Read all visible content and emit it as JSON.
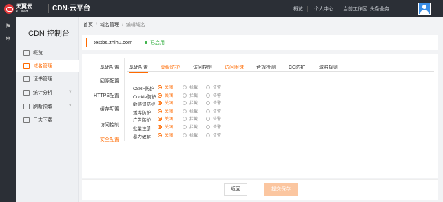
{
  "header": {
    "logo_cn": "天翼云",
    "logo_en": "e Cloud",
    "product_title": "CDN·云平台",
    "links": [
      "概览",
      "个人中心",
      "当前工作区: 头条业务..."
    ]
  },
  "sidebar": {
    "title": "CDN 控制台",
    "items": [
      {
        "label": "概览",
        "active": false
      },
      {
        "label": "域名管理",
        "active": true
      },
      {
        "label": "证书管理",
        "active": false
      },
      {
        "label": "统计分析",
        "active": false,
        "has_caret": true
      },
      {
        "label": "刷新预取",
        "active": false,
        "has_caret": true
      },
      {
        "label": "日志下载",
        "active": false
      }
    ]
  },
  "breadcrumb": {
    "home": "首页",
    "section": "域名管理",
    "current": "编辑域名"
  },
  "domain": {
    "name": "testbs.zhihu.com",
    "status": "已启用",
    "status_color": "#3db34a"
  },
  "config_nav": [
    {
      "label": "基础配置",
      "active": false
    },
    {
      "label": "回源配置",
      "active": false
    },
    {
      "label": "HTTPS配置",
      "active": false
    },
    {
      "label": "缓存配置",
      "active": false
    },
    {
      "label": "访问控制",
      "active": false
    },
    {
      "label": "安全配置",
      "active": true
    }
  ],
  "tabs": [
    {
      "label": "基础配置",
      "state": "active"
    },
    {
      "label": "高级防护",
      "state": "orange"
    },
    {
      "label": "访问控制",
      "state": "normal"
    },
    {
      "label": "访问限速",
      "state": "orange"
    },
    {
      "label": "合规检测",
      "state": "normal"
    },
    {
      "label": "CC防护",
      "state": "normal"
    },
    {
      "label": "域名规则",
      "state": "normal"
    }
  ],
  "rules": {
    "options": [
      "关闭",
      "拦截",
      "告警"
    ],
    "items": [
      {
        "label": "CSRF防护",
        "selected": 0
      },
      {
        "label": "Cookie防护",
        "selected": 0
      },
      {
        "label": "敏感词防护",
        "selected": 0
      },
      {
        "label": "播库防护",
        "selected": 0
      },
      {
        "label": "广告防护",
        "selected": 0
      },
      {
        "label": "批量注册",
        "selected": 0
      },
      {
        "label": "暴力破解",
        "selected": 0
      }
    ]
  },
  "footer": {
    "back_label": "返回",
    "submit_label": "提交保存"
  },
  "colors": {
    "accent": "#ff6a00",
    "topbar": "#2b2f36"
  }
}
